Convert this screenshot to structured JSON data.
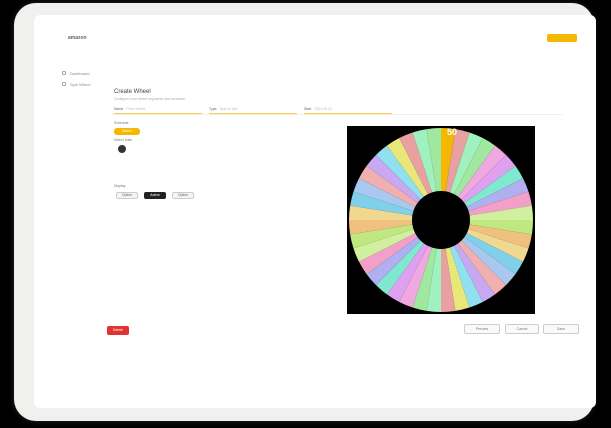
{
  "app": {
    "logo_text": "amazon",
    "top_button": ""
  },
  "nav": [
    {
      "label": "Dashboard"
    },
    {
      "label": "Spin Wheel"
    }
  ],
  "page": {
    "title": "Create Wheel",
    "subtitle": "Configure your wheel segments and schedule"
  },
  "fields": [
    {
      "label": "Name",
      "value": "Prize Wheel"
    },
    {
      "label": "Type",
      "value": "Spin to Win"
    },
    {
      "label": "Start",
      "value": "2024-06-01"
    },
    {
      "label": "",
      "value": ""
    },
    {
      "label": "",
      "value": ""
    }
  ],
  "schedule": {
    "section_label": "Schedule",
    "chip_label": "Select"
  },
  "calendar": {
    "section_label": "Select Date"
  },
  "options": {
    "section_label": "Display",
    "buttons": [
      "Option",
      "Active",
      "Option"
    ]
  },
  "wheel": {
    "marker_label": "50",
    "segment_count": 40
  },
  "footer": {
    "danger_button": "Delete",
    "buttons": [
      "Preview",
      "Cancel",
      "Save"
    ]
  },
  "colors": {
    "accent": "#f5b800",
    "danger": "#e33232",
    "wheel_palette": [
      "#e8e87a",
      "#7fd0e8",
      "#f2a0c8",
      "#a0e8a0",
      "#c8a8f0",
      "#f0c080",
      "#80e8d0",
      "#e8a0a0",
      "#a8c8f0",
      "#d0f0a0",
      "#f0a8e0",
      "#90e0f0",
      "#f0d890",
      "#b0b0f0",
      "#a0f0c0",
      "#f0b0b0",
      "#c0e880",
      "#e0a0f0"
    ]
  }
}
